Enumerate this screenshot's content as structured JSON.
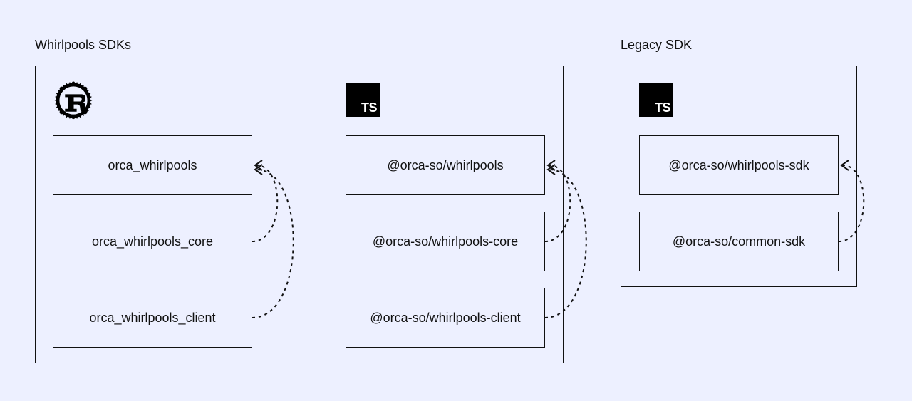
{
  "groups": {
    "whirlpools": {
      "title": "Whirlpools SDKs"
    },
    "legacy": {
      "title": "Legacy SDK"
    }
  },
  "columns": {
    "rust": {
      "icon": "rust",
      "packages": [
        "orca_whirlpools",
        "orca_whirlpools_core",
        "orca_whirlpools_client"
      ]
    },
    "ts1": {
      "icon": "typescript",
      "packages": [
        "@orca-so/whirlpools",
        "@orca-so/whirlpools-core",
        "@orca-so/whirlpools-client"
      ]
    },
    "ts2": {
      "icon": "typescript",
      "packages": [
        "@orca-so/whirlpools-sdk",
        "@orca-so/common-sdk"
      ]
    }
  },
  "icons": {
    "typescript_label": "TS"
  }
}
